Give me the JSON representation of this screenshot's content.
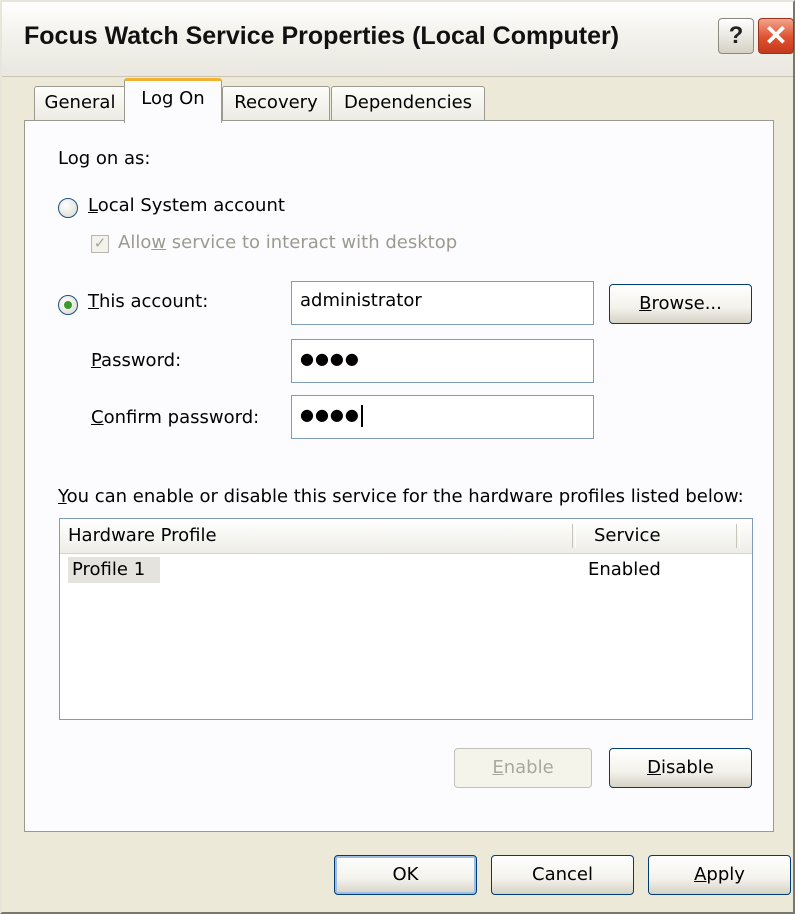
{
  "window": {
    "title": "Focus Watch Service Properties (Local Computer)",
    "help_glyph": "?",
    "close_glyph": "✕"
  },
  "tabs": [
    {
      "label": "General"
    },
    {
      "label": "Log On"
    },
    {
      "label": "Recovery"
    },
    {
      "label": "Dependencies"
    }
  ],
  "logon": {
    "section_label": "Log on as:",
    "local_system": {
      "mnemonic": "L",
      "rest": "ocal System account",
      "selected": false
    },
    "interact_desktop": {
      "pre": "Allo",
      "mnemonic": "w",
      "post": " service to interact with desktop",
      "checked": true,
      "check_glyph": "✓"
    },
    "this_account": {
      "mnemonic": "T",
      "rest": "his account:",
      "selected": true,
      "value": "administrator"
    },
    "browse": {
      "mnemonic": "B",
      "rest": "rowse..."
    },
    "password": {
      "mnemonic": "P",
      "rest": "assword:",
      "value": "●●●●"
    },
    "confirm_password": {
      "mnemonic": "C",
      "rest": "onfirm password:",
      "value": "●●●●"
    }
  },
  "profiles": {
    "instruction_mnemonic": "Y",
    "instruction_rest": "ou can enable or disable this service for the hardware profiles listed below:",
    "columns": [
      "Hardware Profile",
      "Service"
    ],
    "rows": [
      {
        "profile": "Profile 1",
        "service": "Enabled"
      }
    ],
    "enable": {
      "mnemonic": "E",
      "rest": "nable",
      "disabled": true
    },
    "disable": {
      "mnemonic": "D",
      "rest": "isable"
    }
  },
  "footer": {
    "ok": "OK",
    "cancel": "Cancel",
    "apply_mnemonic": "A",
    "apply_rest": "pply"
  }
}
